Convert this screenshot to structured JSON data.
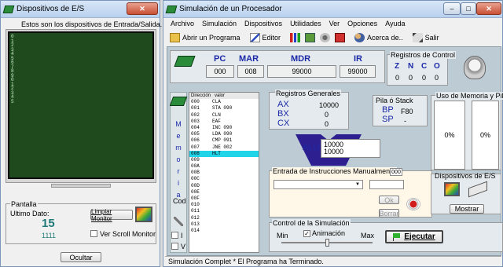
{
  "left_window": {
    "title": "Dispositivos de E/S",
    "close": "✕",
    "heading": "Estos son los dispositivos de Entrada/Salida.",
    "screen_text": "0123456789012345",
    "pantalla_label": "Pantalla",
    "ultimo_dato_label": "Ultimo Dato:",
    "ultimo_dato_value": "15",
    "binary_value": "1111",
    "limpiar_button": "Limpiar Monitor",
    "ver_scroll_label": "Ver Scroll Monitor",
    "ocultar_button": "Ocultar"
  },
  "main_window": {
    "title": "Simulación de un Procesador",
    "minimize": "–",
    "maximize": "□",
    "close": "✕",
    "menu": [
      "Archivo",
      "Simulación",
      "Dispositivos",
      "Utilidades",
      "Ver",
      "Opciones",
      "Ayuda"
    ],
    "toolbar": {
      "abrir": "Abrir un Programa",
      "editor": "Editor",
      "acerca": "Acerca de..",
      "salir": "Salir"
    },
    "registers": {
      "pc_label": "PC",
      "pc_value": "000",
      "mar_label": "MAR",
      "mar_value": "008",
      "mdr_label": "MDR",
      "mdr_value": "99000",
      "ir_label": "IR",
      "ir_value": "99000"
    },
    "control_registers": {
      "title": "Registros de Control",
      "flags": [
        "Z",
        "N",
        "C",
        "O"
      ],
      "values": [
        "0",
        "0",
        "0",
        "0"
      ]
    },
    "general_registers": {
      "title": "Registros Generales",
      "ax_label": "AX",
      "ax_value": "10000",
      "bx_label": "BX",
      "bx_value": "0",
      "cx_label": "CX",
      "cx_value": "0"
    },
    "stack": {
      "title": "Pila ó Stack",
      "bp_label": "BP",
      "bp_value": "F80",
      "sp_label": "SP",
      "sp_value": "-"
    },
    "alu": {
      "label": "ALU",
      "line1": "10000",
      "line2": "10000"
    },
    "memory_usage": {
      "title": "Uso de Memoria y Pila",
      "mem_value": "0%",
      "stack_value": "0%"
    },
    "memory": {
      "side_letters": [
        "M",
        "e",
        "m",
        "o",
        "r",
        "i",
        "a"
      ],
      "cod_label": "Cod",
      "i_label": "I",
      "v_label": "V",
      "header_address": "Dirección",
      "header_value": "valor",
      "rows": [
        {
          "addr": "000",
          "val": "CLA"
        },
        {
          "addr": "001",
          "val": "STA 090"
        },
        {
          "addr": "002",
          "val": "CLN"
        },
        {
          "addr": "003",
          "val": "EAF"
        },
        {
          "addr": "004",
          "val": "INC 090"
        },
        {
          "addr": "005",
          "val": "LDA 090"
        },
        {
          "addr": "006",
          "val": "CMP 091"
        },
        {
          "addr": "007",
          "val": "JNE 002"
        },
        {
          "addr": "008",
          "val": "HLT"
        },
        {
          "addr": "009",
          "val": ""
        },
        {
          "addr": "00A",
          "val": ""
        },
        {
          "addr": "00B",
          "val": ""
        },
        {
          "addr": "00C",
          "val": ""
        },
        {
          "addr": "00D",
          "val": ""
        },
        {
          "addr": "00E",
          "val": ""
        },
        {
          "addr": "00F",
          "val": ""
        },
        {
          "addr": "010",
          "val": ""
        },
        {
          "addr": "011",
          "val": ""
        },
        {
          "addr": "012",
          "val": ""
        },
        {
          "addr": "013",
          "val": ""
        },
        {
          "addr": "014",
          "val": ""
        }
      ]
    },
    "manual_entry": {
      "title": "Entrada de Instrucciones Manualmente",
      "address_value": "000",
      "ok_button": "Ok",
      "borrar_button": "Borrar"
    },
    "io_devices": {
      "title": "Dispositivos de E/S",
      "mostrar_button": "Mostrar"
    },
    "simulation_control": {
      "title": "Control de la Simulación",
      "animacion_label": "Animación",
      "min_label": "Min",
      "max_label": "Max",
      "ejecutar_button": "Ejecutar"
    },
    "status": "Simulación Complet * El Programa ha Terminado."
  }
}
